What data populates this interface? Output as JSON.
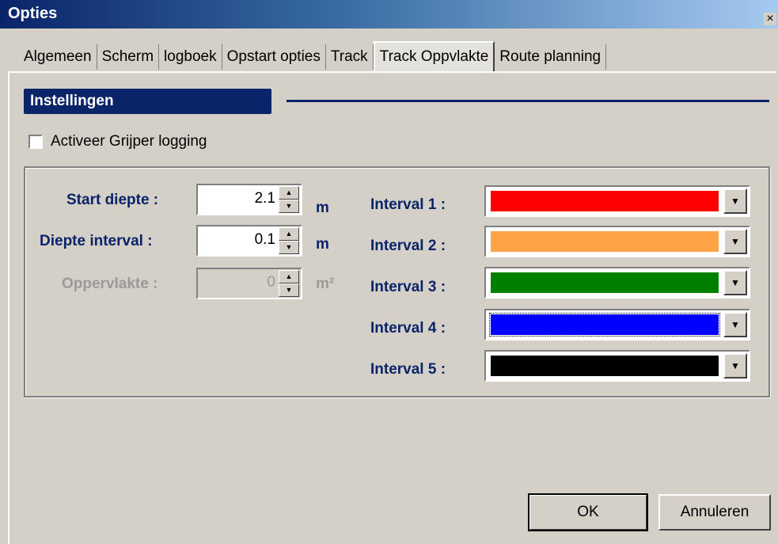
{
  "window": {
    "title": "Opties",
    "close_glyph": "×"
  },
  "tabs": [
    {
      "label": "Algemeen",
      "active": false
    },
    {
      "label": "Scherm",
      "active": false
    },
    {
      "label": "logboek",
      "active": false
    },
    {
      "label": "Opstart opties",
      "active": false
    },
    {
      "label": "Track",
      "active": false
    },
    {
      "label": "Track Oppvlakte",
      "active": true
    },
    {
      "label": "Route planning",
      "active": false
    }
  ],
  "section": {
    "title": "Instellingen"
  },
  "gripper_logging": {
    "label": "Activeer Grijper logging",
    "checked": false
  },
  "fields": {
    "start_depth": {
      "label": "Start diepte :",
      "value": "2.1",
      "unit": "m",
      "enabled": true
    },
    "depth_interval": {
      "label": "Diepte interval :",
      "value": "0.1",
      "unit": "m",
      "enabled": true
    },
    "surface": {
      "label": "Oppervlakte :",
      "value": "0",
      "unit": "m²",
      "enabled": false
    }
  },
  "intervals": [
    {
      "label": "Interval 1 :",
      "color": "#ff0000"
    },
    {
      "label": "Interval 2 :",
      "color": "#ffa348"
    },
    {
      "label": "Interval 3 :",
      "color": "#008000"
    },
    {
      "label": "Interval 4 :",
      "color": "#0000ff"
    },
    {
      "label": "Interval 5 :",
      "color": "#000000"
    }
  ],
  "buttons": {
    "ok": "OK",
    "cancel": "Annuleren"
  },
  "icons": {
    "spin_up": "▲",
    "spin_down": "▼",
    "dropdown": "▼"
  }
}
